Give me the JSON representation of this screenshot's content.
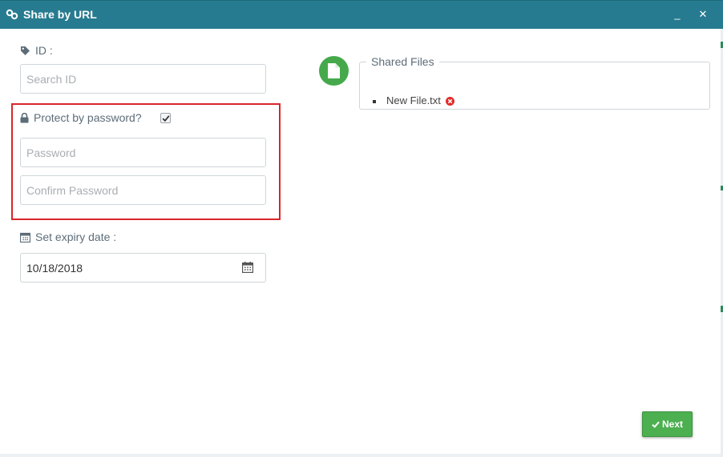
{
  "window": {
    "title": "Share by URL",
    "title_icon": "link-icon",
    "minimize_symbol": "_",
    "close_symbol": "✕",
    "accent_color": "#277b90"
  },
  "form": {
    "id_label": "ID :",
    "id_icon": "tag-icon",
    "id_placeholder": "Search ID",
    "password_toggle_label": "Protect by password?",
    "password_toggle_icon": "lock-icon",
    "password_protected": true,
    "password_placeholder": "Password",
    "confirm_placeholder": "Confirm Password",
    "expiry_label": "Set expiry date :",
    "expiry_icon": "calendar-icon",
    "expiry_value": "10/18/2018",
    "highlight_color": "#d9262b"
  },
  "shared_files": {
    "legend": "Shared Files",
    "icon": "file-icon",
    "items": [
      {
        "name": "New File.txt",
        "remove_icon": "remove-circle-icon"
      }
    ]
  },
  "actions": {
    "next_label": "Next",
    "next_icon": "check-icon",
    "next_color": "#4caf50"
  }
}
